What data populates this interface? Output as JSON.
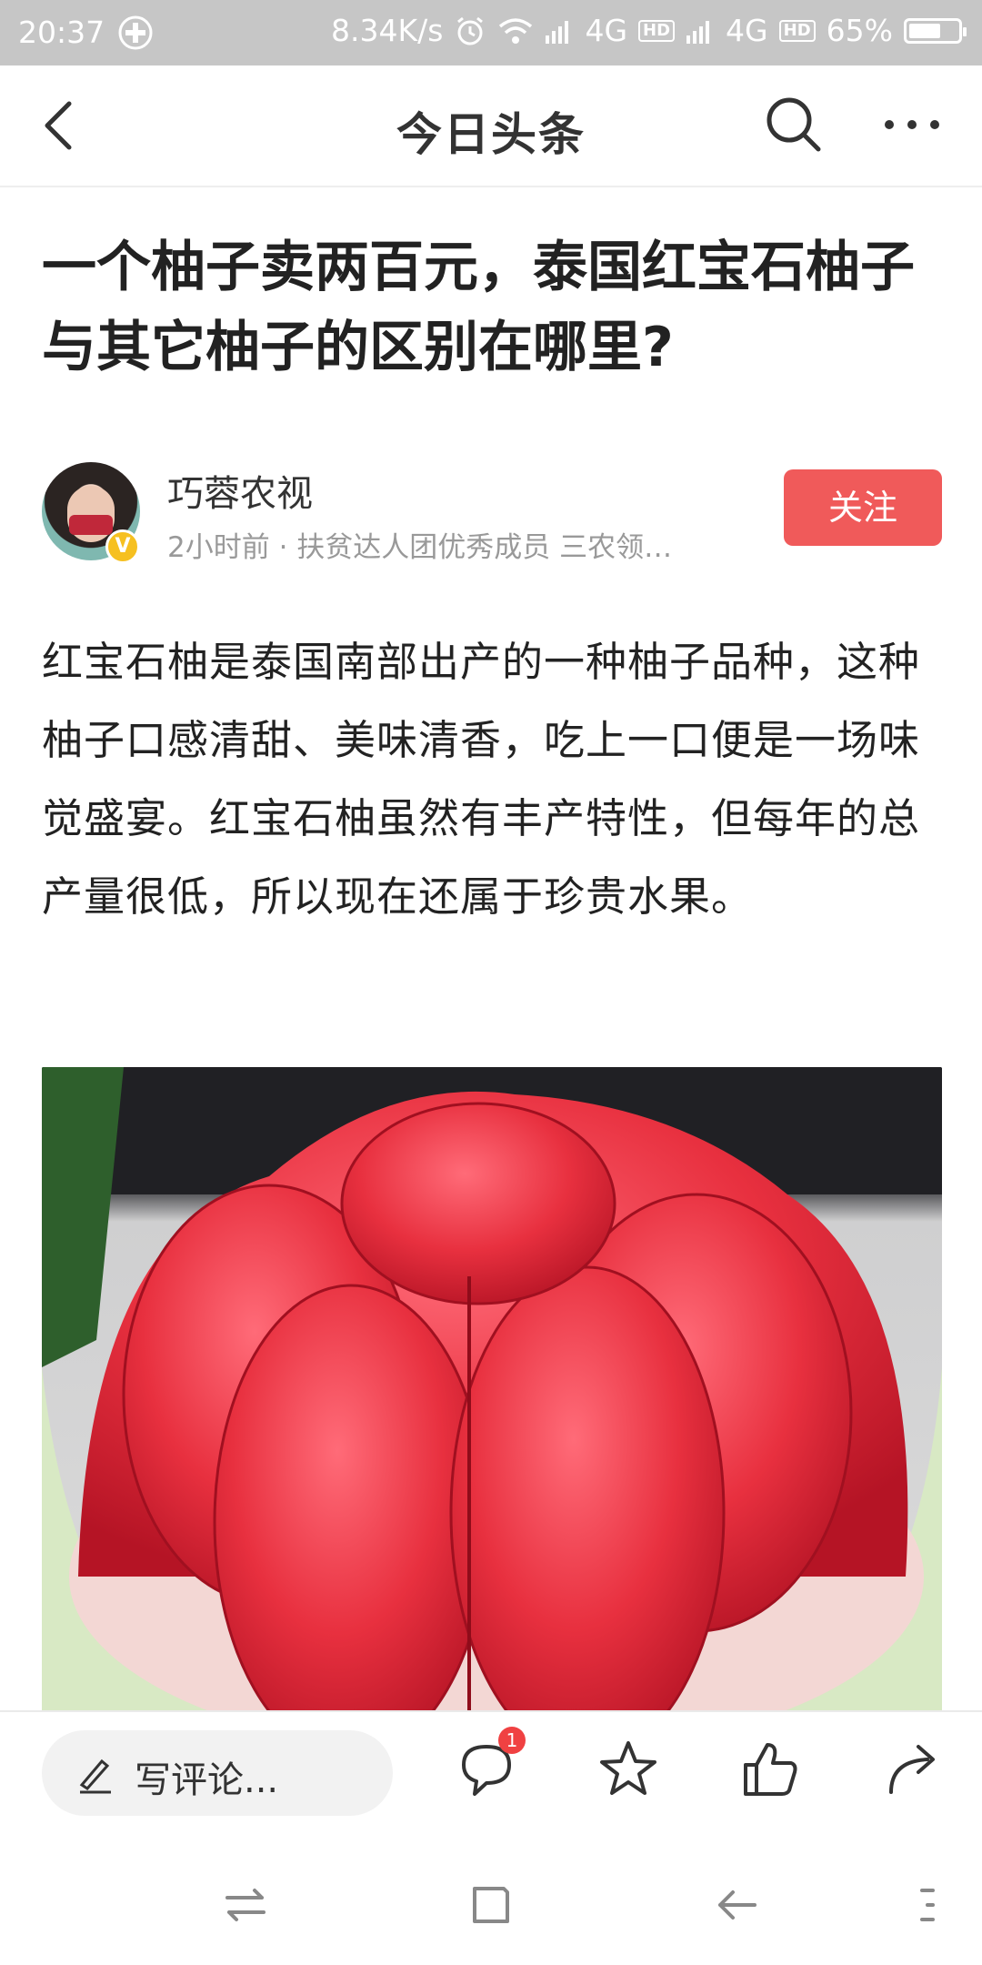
{
  "status_bar": {
    "time": "20:37",
    "net_speed": "8.34K/s",
    "signal1": "4G",
    "hd1": "HD",
    "signal2": "4G",
    "hd2": "HD",
    "battery": "65%",
    "battery_level": 0.65,
    "icons": [
      "add-circle-icon",
      "alarm-icon",
      "wifi-icon",
      "signal-icon",
      "signal-icon",
      "battery-icon"
    ]
  },
  "nav": {
    "title": "今日头条",
    "icons": [
      "back-icon",
      "search-icon",
      "more-icon"
    ]
  },
  "article": {
    "title": "一个柚子卖两百元，泰国红宝石柚子与其它柚子的区别在哪里?",
    "author": {
      "name": "巧蓉农视",
      "verified_badge": "V",
      "meta": "2小时前 · 扶贫达人团优秀成员 三农领…"
    },
    "follow_label": "关注",
    "body": "红宝石柚是泰国南部出产的一种柚子品种，这种柚子口感清甜、美味清香，吃上一口便是一场味觉盛宴。红宝石柚虽然有丰产特性，但每年的总产量很低，所以现在还属于珍贵水果。"
  },
  "bottom_bar": {
    "comment_placeholder": "写评论...",
    "comment_count": "1",
    "icons": [
      "pen-icon",
      "comment-icon",
      "star-icon",
      "thumbs-up-icon",
      "share-icon"
    ]
  },
  "system_nav": {
    "icons": [
      "switch-icon",
      "home-square-icon",
      "back-arrow-icon",
      "menu-icon"
    ]
  },
  "colors": {
    "status_bar_bg": "#c6c6c6",
    "follow_button": "#f05a5a",
    "badge_red": "#f04142"
  }
}
